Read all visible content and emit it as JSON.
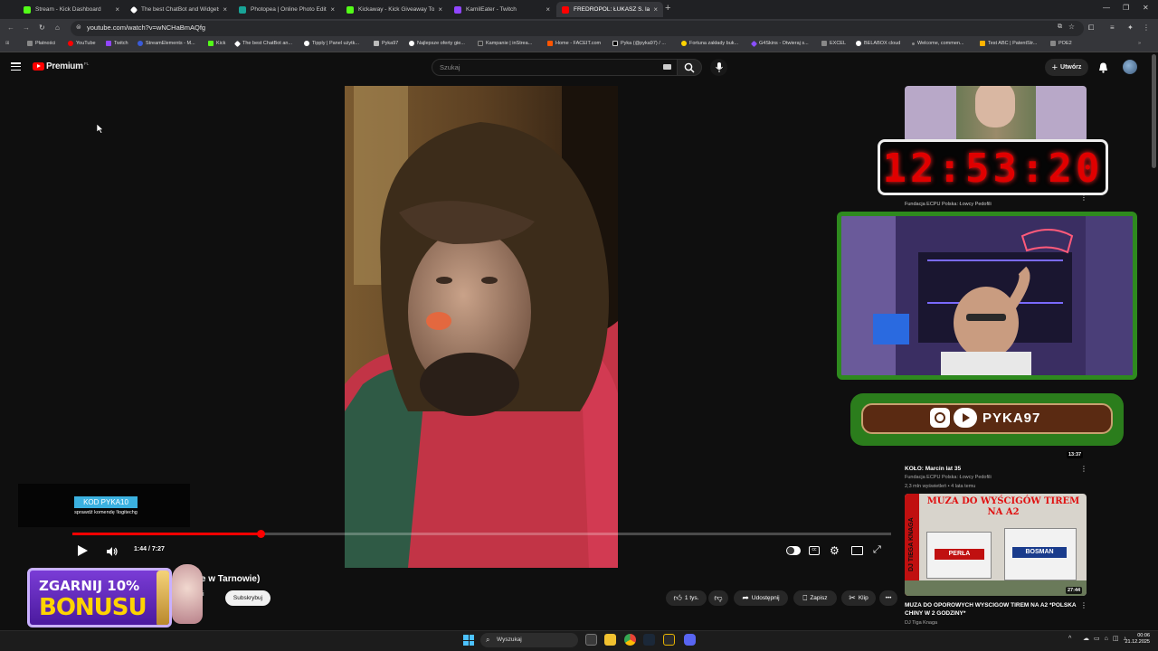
{
  "browser": {
    "tabs": [
      {
        "title": "Stream - Kick Dashboard",
        "color": "#53fc18",
        "active": false
      },
      {
        "title": "The best ChatBot and Widgets",
        "color": "#ffffff",
        "active": false
      },
      {
        "title": "Photopea | Online Photo Editor",
        "color": "#18a497",
        "active": false
      },
      {
        "title": "Kickaway - Kick Giveaway Tool",
        "color": "#53fc18",
        "active": false
      },
      {
        "title": "KamilEater - Twitch",
        "color": "#9146ff",
        "active": false
      },
      {
        "title": "FREDROPOL: ŁUKASZ S. lat 33",
        "color": "#ff0000",
        "active": true
      }
    ],
    "url": "youtube.com/watch?v=wNCHaBmAQfg",
    "bookmarks": [
      {
        "label": "Płatności",
        "color": "#888888"
      },
      {
        "label": "YouTube",
        "color": "#ff0000"
      },
      {
        "label": "Twitch",
        "color": "#9146ff"
      },
      {
        "label": "StreamElements - M...",
        "color": "#3a5bd9"
      },
      {
        "label": "Kick",
        "color": "#53fc18"
      },
      {
        "label": "The best ChatBot an...",
        "color": "#ffffff"
      },
      {
        "label": "Tipply | Panel użytk...",
        "color": "#ffffff"
      },
      {
        "label": "Pyka97",
        "color": "#bbbbbb"
      },
      {
        "label": "Najlepsze oferty gie...",
        "color": "#ffffff"
      },
      {
        "label": "Kampanie | inStrea...",
        "color": "#333333"
      },
      {
        "label": "Home - FACEIT.com",
        "color": "#ff5500"
      },
      {
        "label": "Pyka (@pyka97) / ...",
        "color": "#000000"
      },
      {
        "label": "Fortuna zakłady buk...",
        "color": "#ffd400"
      },
      {
        "label": "G4Skins - Otwieraj s...",
        "color": "#8a4fff"
      },
      {
        "label": "EXCEL",
        "color": "#888888"
      },
      {
        "label": "BELABOX cloud",
        "color": "#ffffff"
      },
      {
        "label": "Welcome, commen...",
        "color": "#888888"
      },
      {
        "label": "Test ABC | PatentStr...",
        "color": "#ffb300"
      },
      {
        "label": "POE2",
        "color": "#888888"
      }
    ]
  },
  "youtube": {
    "logo": "Premium",
    "logo_suffix": "PL",
    "search_placeholder": "Szukaj",
    "create_label": "Utwórz"
  },
  "player": {
    "promo_code": "KOD PYKA10",
    "promo_sub": "sprawdź komendę !logitechg",
    "time": "1:44 / 7:27",
    "progress": 0.23
  },
  "video": {
    "title_visible": "ujęcie w Tarnowie)",
    "title_partial": "t",
    "channel_partial": "w",
    "channel_suffix": "ofili",
    "subscribe_label": "Subskrybuj",
    "likes": "1 tys.",
    "share": "Udostępnij",
    "save": "Zapisz",
    "clip": "Klip"
  },
  "bonus_banner": {
    "line1": "ZGARNIJ 10%",
    "line2": "BONUSU"
  },
  "overlay": {
    "timer": "12:53:20",
    "handle": "PYKA97"
  },
  "recommendations": [
    {
      "title": "",
      "channel": "Fundacja ECPU Polska: Łowcy Pedofili",
      "meta": "",
      "duration": ""
    },
    {
      "title": "KOŁO: Marcin lat 35",
      "channel": "Fundacja ECPU Polska: Łowcy Pedofili",
      "meta": "2,3 mln wyświetleń • 4 lata temu",
      "duration": "13:37"
    },
    {
      "title": "MUZA DO OPOROWYCH WYSCIGOW TIREM NA A2 *POLSKA CHINY W 2 GODZINY*",
      "channel": "DJ Tiga Knaga",
      "meta": "",
      "duration": "27:44",
      "thumb_text": "MUZA DO WYŚCIGÓW TIREM NA A2",
      "thumb_side": "DJ TIEGA KNAGA",
      "trucks": [
        "PERŁA",
        "BOSMAN"
      ]
    }
  ],
  "taskbar": {
    "search": "Wyszukaj",
    "time": "00:06",
    "date": "21.12.2025"
  }
}
